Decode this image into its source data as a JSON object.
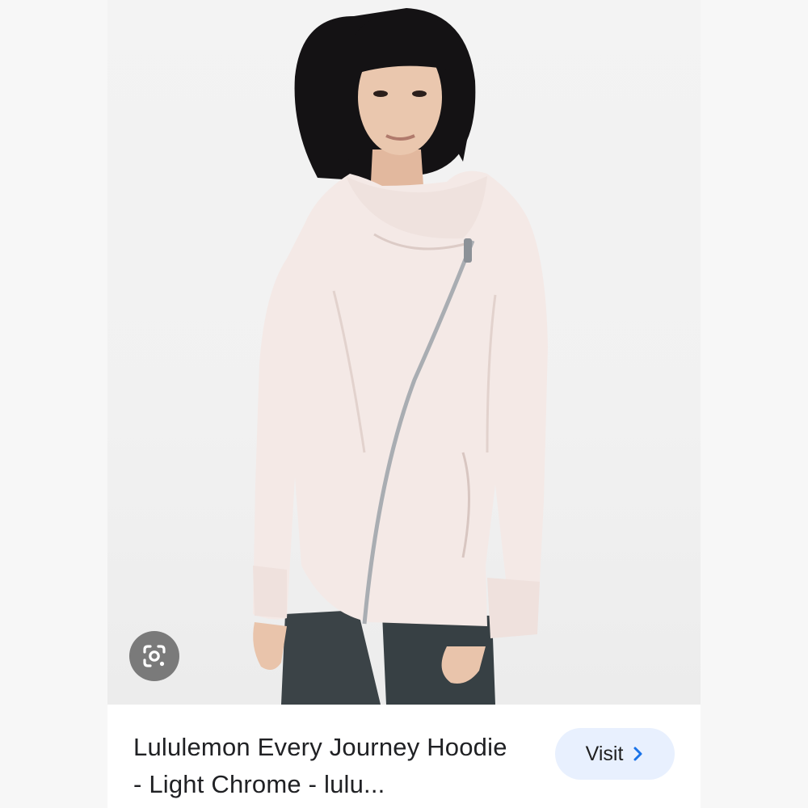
{
  "result": {
    "title": "Lululemon Every Journey Hoodie - Light Chrome - lulu...",
    "visit_label": "Visit"
  },
  "icons": {
    "lens": "google-lens-icon",
    "visit_arrow": "chevron-right-icon"
  },
  "colors": {
    "visit_bg": "#e8f0fe",
    "visit_arrow": "#1a73e8",
    "lens_bg": "#5a5a5a",
    "hoodie": "#f4e9e6",
    "leggings": "#3b4347"
  }
}
